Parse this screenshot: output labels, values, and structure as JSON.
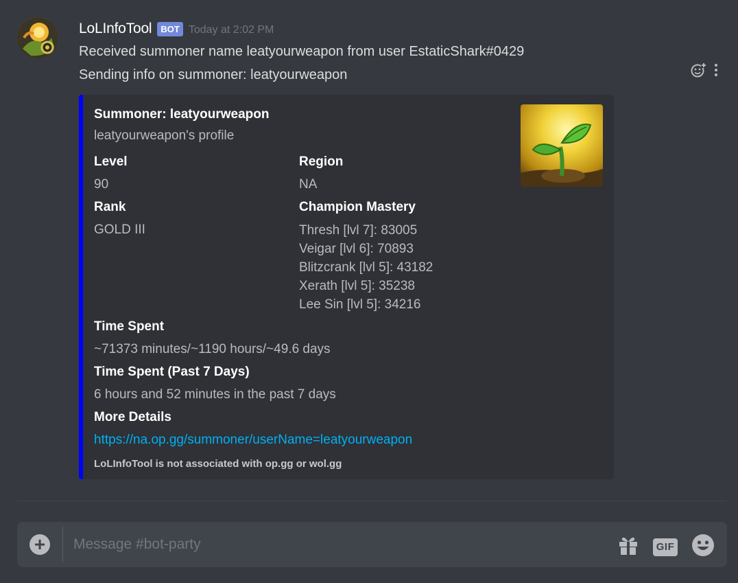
{
  "message": {
    "username": "LoLInfoTool",
    "bot_tag": "BOT",
    "timestamp": "Today at 2:02 PM",
    "lines": [
      "Received summoner name leatyourweapon from user EstaticShark#0429",
      "Sending info on summoner: leatyourweapon"
    ],
    "actions": {
      "add_reaction_icon": "add-reaction-icon",
      "more_icon": "more-options-icon"
    }
  },
  "embed": {
    "accent_color": "#0000ff",
    "title": "Summoner: leatyourweapon",
    "description": "leatyourweapon's profile",
    "thumbnail_icon": "seedling-icon",
    "fields": {
      "level": {
        "name": "Level",
        "value": "90"
      },
      "region": {
        "name": "Region",
        "value": "NA"
      },
      "rank": {
        "name": "Rank",
        "value": "GOLD III"
      },
      "mastery": {
        "name": "Champion Mastery",
        "items": [
          "Thresh [lvl 7]: 83005",
          "Veigar [lvl 6]: 70893",
          "Blitzcrank [lvl 5]: 43182",
          "Xerath [lvl 5]: 35238",
          "Lee Sin [lvl 5]: 34216"
        ]
      },
      "time_spent": {
        "name": "Time Spent",
        "value": "~71373 minutes/~1190 hours/~49.6 days"
      },
      "time_spent_week": {
        "name": "Time Spent (Past 7 Days)",
        "value": "6 hours and 52 minutes in the past 7 days"
      },
      "more_details": {
        "name": "More Details",
        "value": "https://na.op.gg/summoner/userName=leatyourweapon"
      }
    },
    "footer": "LoLInfoTool is not associated with op.gg or wol.gg"
  },
  "composer": {
    "placeholder": "Message #bot-party",
    "attach_label": "+",
    "gif_label": "GIF",
    "gift_icon": "gift-icon",
    "emoji_icon": "emoji-icon"
  }
}
